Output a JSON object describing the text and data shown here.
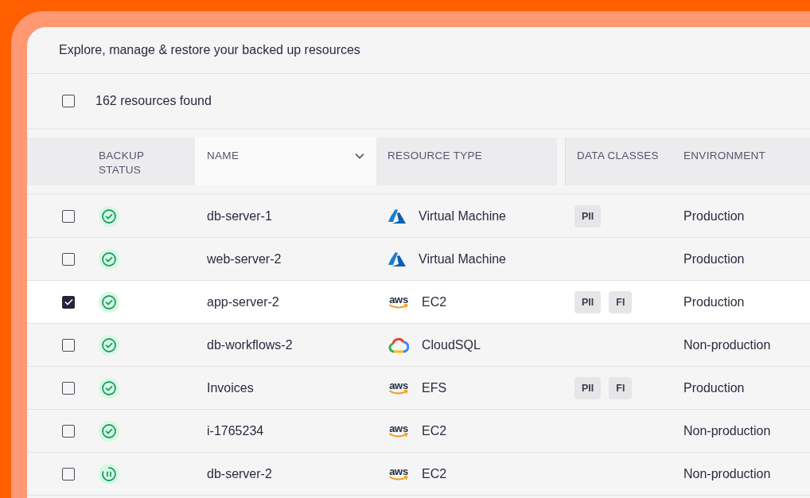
{
  "page": {
    "subtitle": "Explore, manage & restore your backed up resources"
  },
  "toolbar": {
    "select_all_checked": false,
    "count": "162 resources found"
  },
  "table": {
    "columns": [
      {
        "label": "BACKUP STATUS",
        "sortable": false
      },
      {
        "label": "NAME",
        "sortable": true
      },
      {
        "label": "RESOURCE TYPE",
        "sortable": false
      },
      {
        "label": "DATA CLASSES",
        "sortable": false
      },
      {
        "label": "ENVIRONMENT",
        "sortable": false
      }
    ],
    "rows": [
      {
        "selected": false,
        "status_icon": {
          "kind": "ok"
        },
        "name": "db-server-1",
        "type_icon": {
          "kind": "azure"
        },
        "type": "Virtual Machine",
        "data_classes": [
          "PII"
        ],
        "environment": "Production"
      },
      {
        "selected": false,
        "status_icon": {
          "kind": "ok"
        },
        "name": "web-server-2",
        "type_icon": {
          "kind": "azure"
        },
        "type": "Virtual Machine",
        "environment": "Production"
      },
      {
        "selected": true,
        "status_icon": {
          "kind": "ok"
        },
        "name": "app-server-2",
        "type_icon": {
          "kind": "aws",
          "text": "aws"
        },
        "type": "EC2",
        "data_classes": [
          "PII",
          "FI"
        ],
        "environment": "Production"
      },
      {
        "selected": false,
        "status_icon": {
          "kind": "ok"
        },
        "name": "db-workflows-2",
        "type_icon": {
          "kind": "gcp"
        },
        "type": "CloudSQL",
        "environment": "Non-production"
      },
      {
        "selected": false,
        "status_icon": {
          "kind": "ok"
        },
        "name": "Invoices",
        "type_icon": {
          "kind": "aws",
          "text": "aws"
        },
        "type": "EFS",
        "data_classes": [
          "PII",
          "FI"
        ],
        "environment": "Production"
      },
      {
        "selected": false,
        "status_icon": {
          "kind": "ok"
        },
        "name": "i-1765234",
        "type_icon": {
          "kind": "aws",
          "text": "aws"
        },
        "type": "EC2",
        "environment": "Non-production"
      },
      {
        "selected": false,
        "status_icon": {
          "kind": "paused"
        },
        "name": "db-server-2",
        "type_icon": {
          "kind": "aws",
          "text": "aws"
        },
        "type": "EC2",
        "environment": "Non-production"
      }
    ]
  }
}
